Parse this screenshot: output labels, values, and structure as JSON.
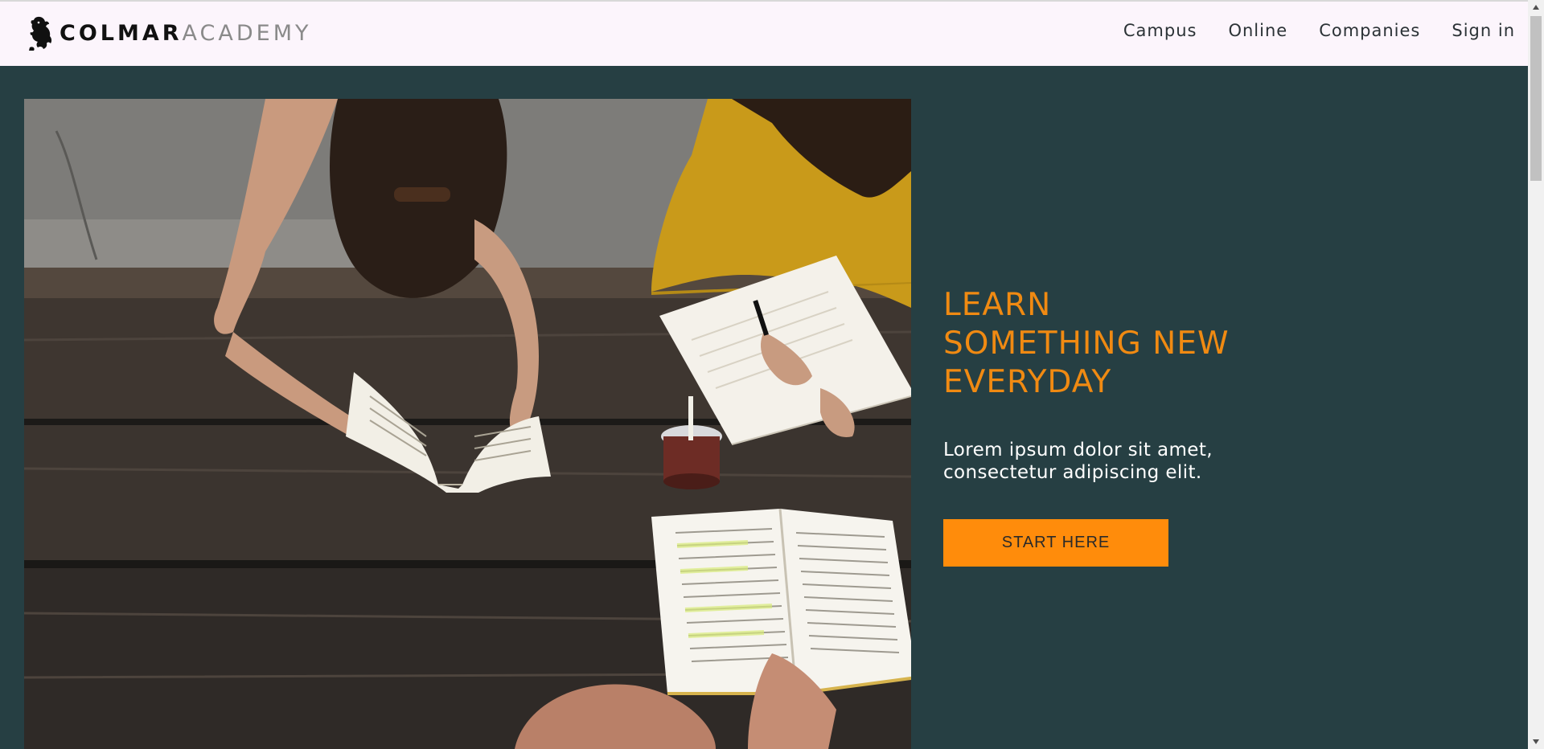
{
  "header": {
    "brand_strong": "COLMAR",
    "brand_light": "ACADEMY",
    "nav": [
      {
        "label": "Campus"
      },
      {
        "label": "Online"
      },
      {
        "label": "Companies"
      },
      {
        "label": "Sign in"
      }
    ]
  },
  "hero": {
    "title": "LEARN\nSOMETHING NEW\nEVERYDAY",
    "subtitle": "Lorem ipsum dolor sit amet,\nconsectetur adipiscing elit.",
    "cta_label": "START HERE"
  },
  "colors": {
    "page_bg": "#263f43",
    "header_bg": "#fcf5fc",
    "accent": "#f08a12",
    "cta_bg": "#ff8c0b"
  },
  "icons": {
    "logo": "lion-rampant-icon",
    "scroll_up": "arrow-up-icon",
    "scroll_down": "arrow-down-icon"
  }
}
